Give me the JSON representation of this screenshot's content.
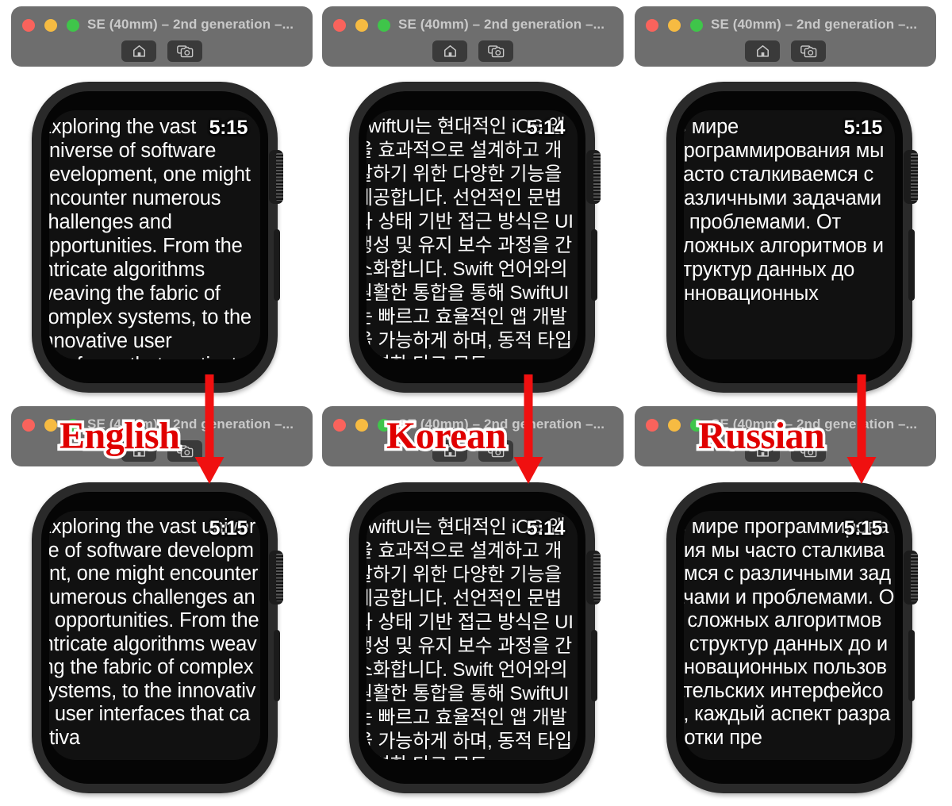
{
  "page": {
    "background": "#ffffff",
    "accent_red": "#e00000",
    "chrome_bg": "#6e6e6e"
  },
  "windows": [
    {
      "title": "SE (40mm) – 2nd generation –...",
      "buttons": {
        "home": "home-button",
        "screenshot": "screenshot-button"
      }
    },
    {
      "title": "SE (40mm) – 2nd generation –...",
      "buttons": {
        "home": "home-button",
        "screenshot": "screenshot-button"
      }
    },
    {
      "title": "SE (40mm) – 2nd generation –...",
      "buttons": {
        "home": "home-button",
        "screenshot": "screenshot-button"
      }
    },
    {
      "title": "SE (40mm) – 2nd generation –...",
      "buttons": {
        "home": "home-button",
        "screenshot": "screenshot-button"
      }
    },
    {
      "title": "SE (40mm) – 2nd generation –...",
      "buttons": {
        "home": "home-button",
        "screenshot": "screenshot-button"
      }
    },
    {
      "title": "SE (40mm) – 2nd generation –...",
      "buttons": {
        "home": "home-button",
        "screenshot": "screenshot-button"
      }
    }
  ],
  "annotations": [
    {
      "label": "English"
    },
    {
      "label": "Korean"
    },
    {
      "label": "Russian"
    }
  ],
  "watches": {
    "top": [
      {
        "language": "English",
        "time": "5:15",
        "wrap_mode": "word",
        "body": "Exploring the vast universe of software development, one might encounter numerous challenges and opportunities. From the intricate algorithms weaving the fabric of complex systems, to the innovative user interfaces that captivate"
      },
      {
        "language": "Korean",
        "time": "5:14",
        "wrap_mode": "word",
        "body": "SwiftUI는 현대적인 iOS 앱을 효과적으로 설계하고 개발하기 위한 다양한 기능을 제공합니다. 선언적인 문법과 상태 기반 접근 방식은 UI 생성 및 유지 보수 과정을 간소화합니다. Swift 언어와의 원활한 통합을 통해 SwiftUI는 빠르고 효율적인 앱 개발을 가능하게 하며, 동적 타입 지역화 다크 모드"
      },
      {
        "language": "Russian",
        "time": "5:15",
        "wrap_mode": "word",
        "body": "В мире программирования мы часто сталкиваемся с различными задачами и проблемами. От сложных алгоритмов и структур данных до инновационных"
      }
    ],
    "bottom": [
      {
        "language": "English",
        "time": "5:15",
        "wrap_mode": "character",
        "body": "Exploring the vast universe of software development, one might encounter numerous challenges and opportunities. From the intricate algorithms weaving the fabric of complex systems, to the innovative user interfaces that captiva"
      },
      {
        "language": "Korean",
        "time": "5:14",
        "wrap_mode": "character",
        "body": "SwiftUI는 현대적인 iOS 앱을 효과적으로 설계하고 개발하기 위한 다양한 기능을 제공합니다. 선언적인 문법과 상태 기반 접근 방식은 UI 생성 및 유지 보수 과정을 간소화합니다. Swift 언어와의 원활한 통합을 통해 SwiftUI는 빠르고 효율적인 앱 개발을 가능하게 하며, 동적 타입 지역화 다크 모드"
      },
      {
        "language": "Russian",
        "time": "5:15",
        "wrap_mode": "character",
        "body": "В мире программирования мы часто сталкиваемся с различными задачами и проблемами. От сложных алгоритмов и структур данных до инновационных пользовательских интерфейсов, каждый аспект разработки пре"
      }
    ]
  },
  "icons": {
    "home": "home-icon",
    "screenshot": "camera-icon",
    "close": "close-traffic-light",
    "minimize": "minimize-traffic-light",
    "zoom": "zoom-traffic-light"
  }
}
